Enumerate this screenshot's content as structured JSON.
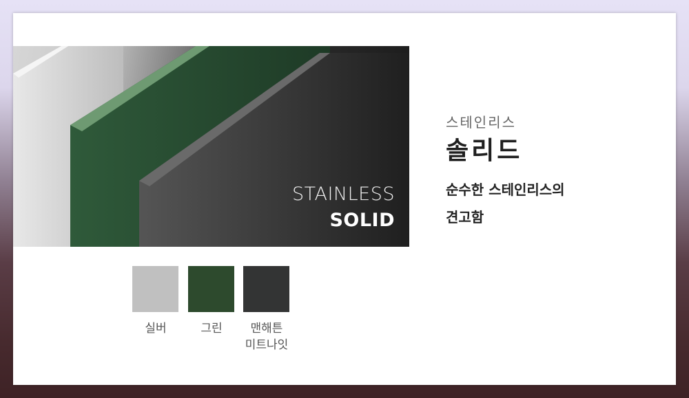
{
  "hero": {
    "line1": "STAINLESS",
    "line2": "SOLID"
  },
  "product": {
    "subtitle": "스테인리스",
    "title": "솔리드",
    "description": "순수한 스테인리스의\n견고함"
  },
  "swatches": [
    {
      "label": "실버",
      "color": "#c0c0c0"
    },
    {
      "label": "그린",
      "color": "#2d4a2d"
    },
    {
      "label": "맨해튼\n미트나잇",
      "color": "#333434"
    }
  ]
}
